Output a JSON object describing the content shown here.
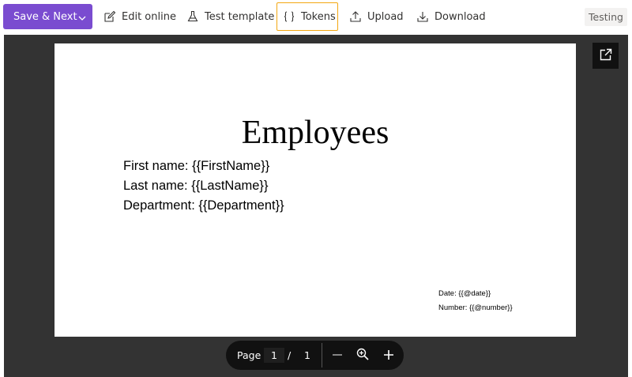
{
  "toolbar": {
    "save_next_label": "Save & Next",
    "edit_online_label": "Edit online",
    "test_template_label": "Test template",
    "tokens_label": "Tokens",
    "upload_label": "Upload",
    "download_label": "Download",
    "status_label": "Testing",
    "primary_color": "#7a4cd0",
    "active_border_color": "#f3a712"
  },
  "document": {
    "title": "Employees",
    "fields": [
      "First name: {{FirstName}}",
      "Last name: {{LastName}}",
      "Department: {{Department}}"
    ],
    "footer": {
      "date": "Date: {{@date}}",
      "number": "Number: {{@number}}"
    }
  },
  "pager": {
    "page_label": "Page",
    "current_page": "1",
    "separator": "/",
    "total_pages": "1"
  },
  "icons": [
    "chevron-down-icon",
    "edit-icon",
    "flask-icon",
    "braces-icon",
    "upload-icon",
    "download-icon",
    "open-external-icon",
    "zoom-out-icon",
    "zoom-icon",
    "zoom-in-icon"
  ]
}
